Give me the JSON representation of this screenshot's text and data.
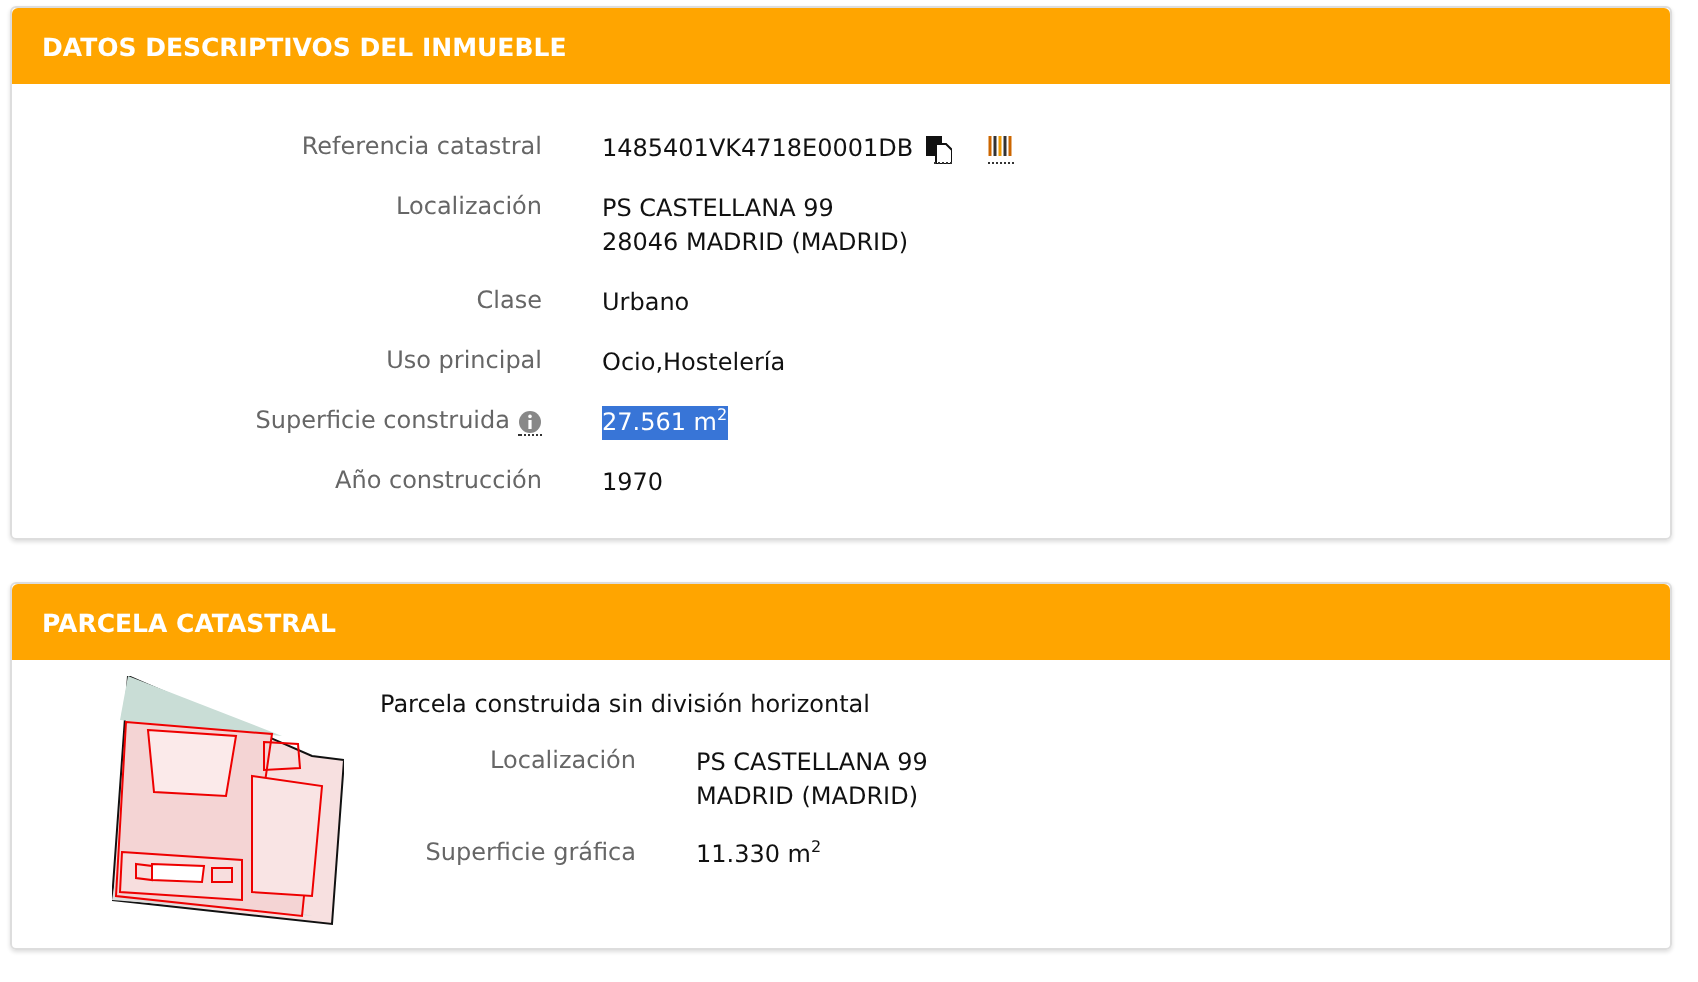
{
  "panels": [
    {
      "title": "DATOS DESCRIPTIVOS DEL INMUEBLE",
      "rows": [
        {
          "kind": "reference",
          "label": "Referencia catastral",
          "lines": [
            "1485401VK4718E0001DB"
          ],
          "highlighted": false
        },
        {
          "kind": "plain",
          "label": "Localización",
          "lines": [
            "PS CASTELLANA 99",
            "28046 MADRID (MADRID)"
          ],
          "highlighted": false
        },
        {
          "kind": "plain",
          "label": "Clase",
          "lines": [
            "Urbano"
          ],
          "highlighted": false
        },
        {
          "kind": "plain",
          "label": "Uso principal",
          "lines": [
            "Ocio,Hostelería"
          ],
          "highlighted": false
        },
        {
          "kind": "info",
          "label": "Superficie construida",
          "lines": [
            "27.561 m$^{2}$"
          ],
          "highlighted": true
        },
        {
          "kind": "plain",
          "label": "Año construcción",
          "lines": [
            "1970"
          ],
          "highlighted": false
        }
      ]
    },
    {
      "title": "PARCELA CATASTRAL",
      "kind": "parcel",
      "subtitle": "Parcela construida sin división horizontal",
      "rows": [
        {
          "kind": "plain",
          "label": "Localización",
          "lines": [
            "PS CASTELLANA 99",
            "MADRID (MADRID)"
          ],
          "highlighted": false
        },
        {
          "kind": "plain",
          "label": "Superficie gráfica",
          "lines": [
            "11.330 m$^{2}$"
          ],
          "highlighted": false
        }
      ]
    }
  ]
}
